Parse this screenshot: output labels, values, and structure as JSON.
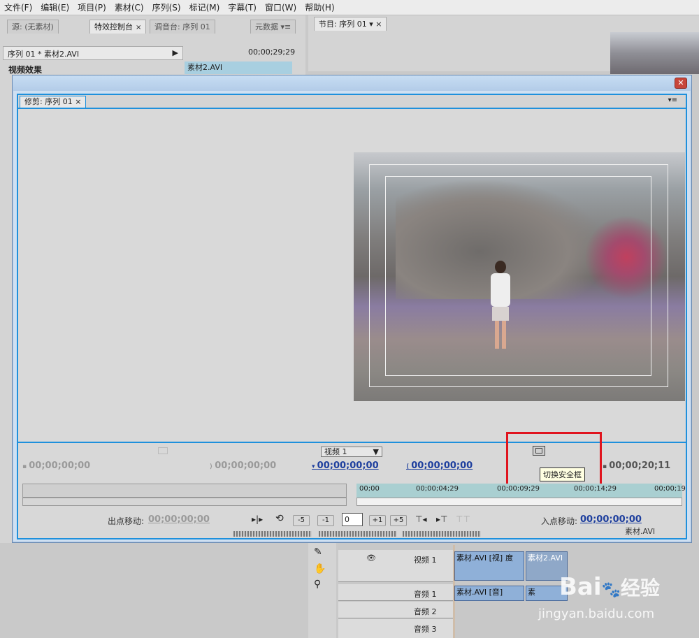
{
  "menu": [
    "文件(F)",
    "编辑(E)",
    "项目(P)",
    "素材(C)",
    "序列(S)",
    "标记(M)",
    "字幕(T)",
    "窗口(W)",
    "帮助(H)"
  ],
  "left_tabs": {
    "source": "源: (无素材)",
    "effect_controls": "特效控制台",
    "audio_mixer": "调音台: 序列 01",
    "metadata": "元数据"
  },
  "program_tab": "节目: 序列 01",
  "effect_controls": {
    "header": "序列 01 * 素材2.AVI",
    "timecode": "00;00;29;29",
    "video_effects": "视频效果",
    "clip": "素材2.AVI"
  },
  "trim": {
    "tab": "修剪: 序列 01",
    "track_select": "视频 1",
    "tc_left": "00;00;00;00",
    "tc_left2": "00;00;00;00",
    "tc_out": "00;00;00;00",
    "tc_in": "00;00;00;00",
    "tc_right": "00;00;20;11",
    "tooltip": "切换安全框",
    "ruler": [
      "00;00",
      "00;00;04;29",
      "00;00;09;29",
      "00;00;14;29",
      "00;00;19"
    ],
    "out_shift_label": "出点移动:",
    "out_shift_value": "00;00;00;00",
    "in_shift_label": "入点移动:",
    "in_shift_value": "00;00;00;00",
    "step_values": [
      "-5",
      "-1",
      "+1",
      "+5"
    ],
    "field_value": "0",
    "clip_name": "素材.AVI"
  },
  "timeline": {
    "video1": "视频 1",
    "audio1": "音频 1",
    "audio2": "音频 2",
    "audio3": "音频 3",
    "clip_video": "素材.AVI [视]",
    "clip_video_suffix": "度",
    "clip_video2": "素材2.AVI",
    "clip_audio": "素材.AVI [音]",
    "clip_audio2": "素"
  },
  "watermark": {
    "logo": "Bai",
    "brand": "经验",
    "url": "jingyan.baidu.com"
  },
  "colors": {
    "accent_blue": "#1e90dc",
    "highlight_red": "#e0141e",
    "timecode_blue": "#1e3f9e"
  }
}
